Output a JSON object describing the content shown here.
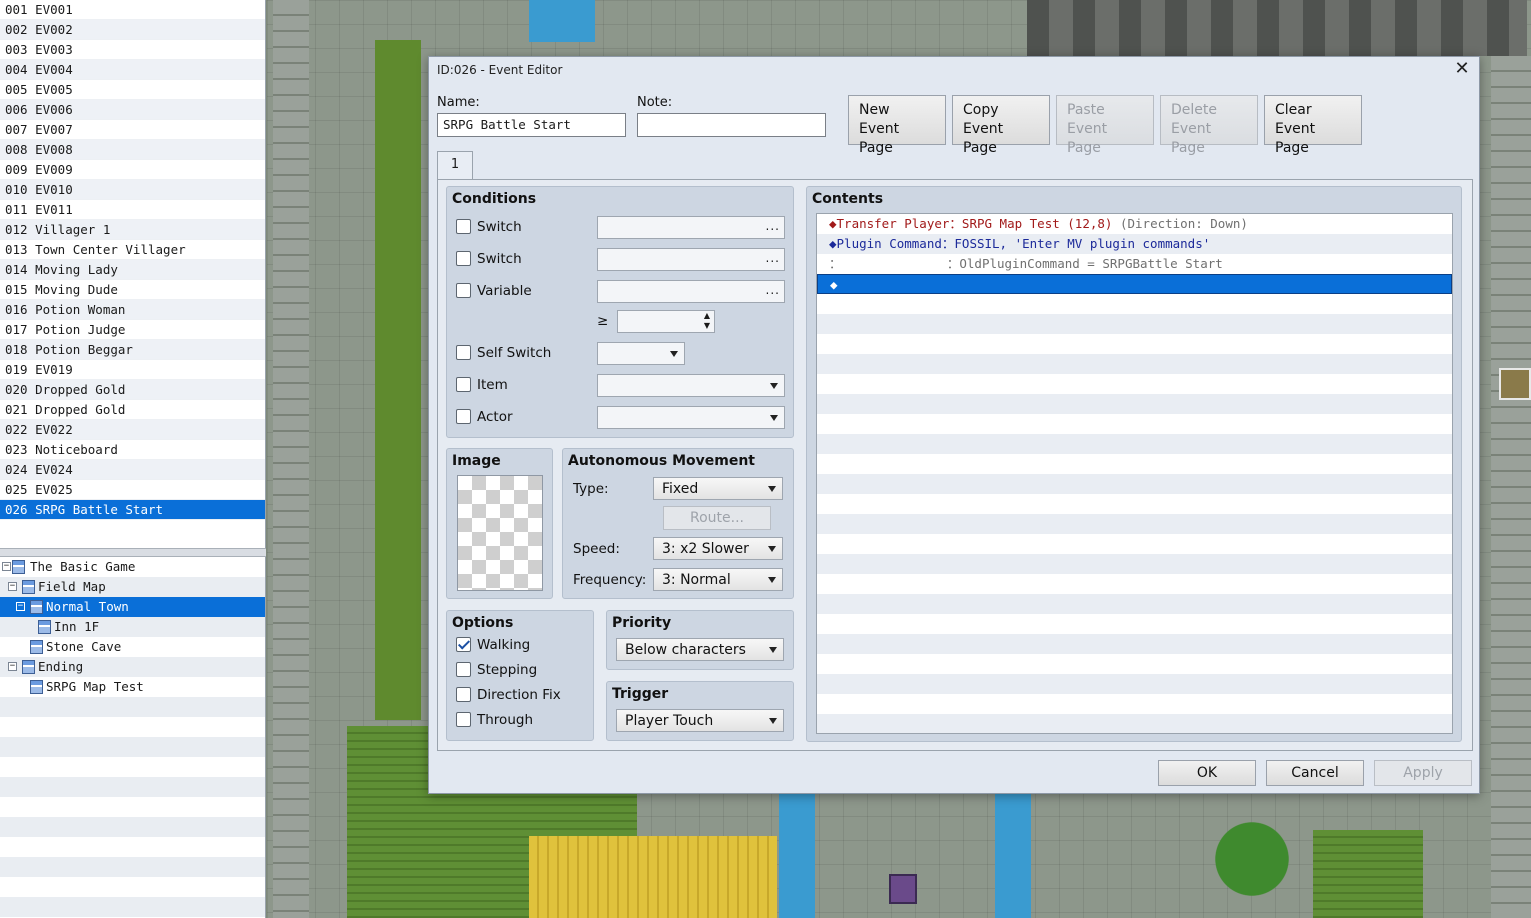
{
  "event_list": [
    "001 EV001",
    "002 EV002",
    "003 EV003",
    "004 EV004",
    "005 EV005",
    "006 EV006",
    "007 EV007",
    "008 EV008",
    "009 EV009",
    "010 EV010",
    "011 EV011",
    "012 Villager 1",
    "013 Town Center Villager",
    "014 Moving Lady",
    "015 Moving Dude",
    "016 Potion Woman",
    "017 Potion Judge",
    "018 Potion Beggar",
    "019 EV019",
    "020 Dropped Gold",
    "021 Dropped Gold",
    "022 EV022",
    "023 Noticeboard",
    "024 EV024",
    "025 EV025",
    "026 SRPG Battle Start"
  ],
  "map_tree": [
    {
      "label": "The Basic Game",
      "exp": "−"
    },
    {
      "label": "Field Map",
      "exp": "−"
    },
    {
      "label": "Normal Town",
      "exp": "−"
    },
    {
      "label": "Inn 1F",
      "exp": ""
    },
    {
      "label": "Stone Cave",
      "exp": ""
    },
    {
      "label": "Ending",
      "exp": "−"
    },
    {
      "label": "SRPG Map Test",
      "exp": ""
    }
  ],
  "dialog": {
    "title": "ID:026 - Event Editor",
    "close": "✕",
    "name_label": "Name:",
    "name_value": "SRPG Battle Start",
    "note_label": "Note:",
    "note_value": "",
    "buttons": {
      "new": [
        "New",
        "Event Page"
      ],
      "copy": [
        "Copy",
        "Event Page"
      ],
      "paste": [
        "Paste",
        "Event Page"
      ],
      "delete": [
        "Delete",
        "Event Page"
      ],
      "clear": [
        "Clear",
        "Event Page"
      ]
    },
    "tab": "1",
    "conditions": {
      "title": "Conditions",
      "switch1": "Switch",
      "switch2": "Switch",
      "variable": "Variable",
      "ge": "≥",
      "self_switch": "Self Switch",
      "item": "Item",
      "actor": "Actor",
      "dots": "..."
    },
    "image": {
      "title": "Image"
    },
    "movement": {
      "title": "Autonomous Movement",
      "type_label": "Type:",
      "type_value": "Fixed",
      "route": "Route...",
      "speed_label": "Speed:",
      "speed_value": "3: x2 Slower",
      "freq_label": "Frequency:",
      "freq_value": "3: Normal"
    },
    "options": {
      "title": "Options",
      "walking": "Walking",
      "stepping": "Stepping",
      "direction_fix": "Direction Fix",
      "through": "Through"
    },
    "priority": {
      "title": "Priority",
      "value": "Below characters"
    },
    "trigger": {
      "title": "Trigger",
      "value": "Player Touch"
    },
    "contents": {
      "title": "Contents",
      "lines": [
        {
          "a": "◆Transfer Player：",
          "b": "SRPG Map Test (12,8)",
          "c": " (Direction: Down)"
        },
        {
          "a": "◆Plugin Command：",
          "b": "FOSSIL, 'Enter MV plugin commands'",
          "c": ""
        },
        {
          "a": "：",
          "b": "",
          "c": "              ：OldPluginCommand = SRPGBattle Start"
        },
        {
          "a": "◆",
          "b": "",
          "c": ""
        }
      ]
    },
    "ok": "OK",
    "cancel": "Cancel",
    "apply": "Apply"
  }
}
